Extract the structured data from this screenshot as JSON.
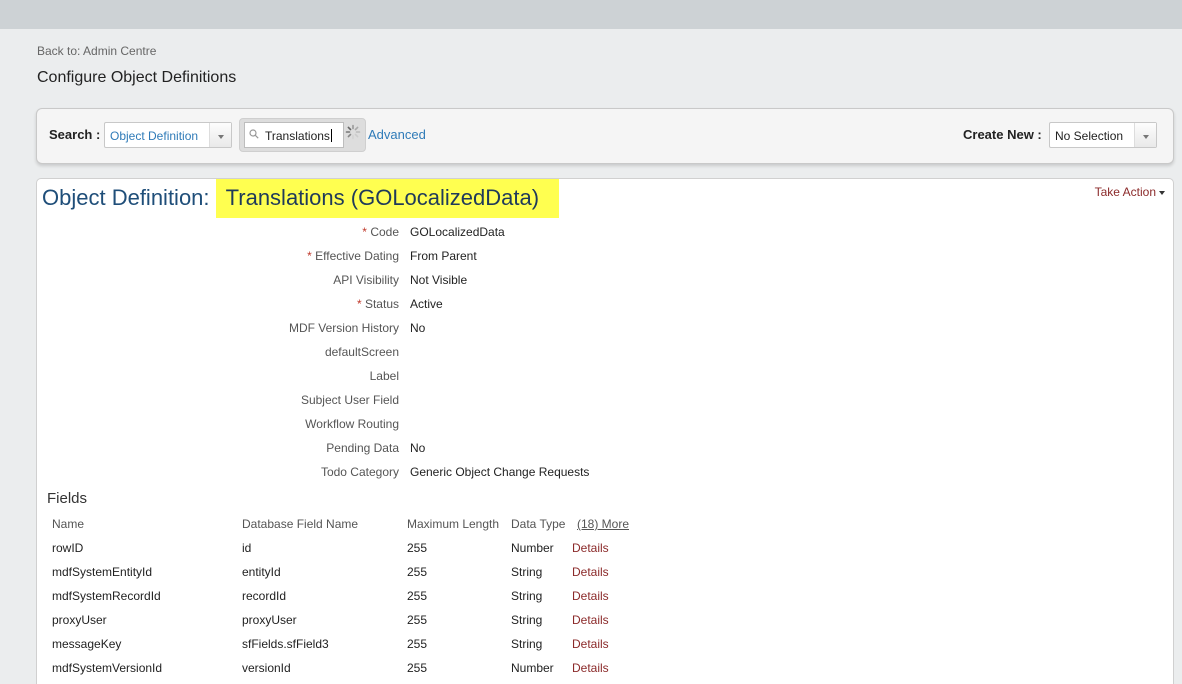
{
  "nav": {
    "back": "Back to: Admin Centre",
    "page_title": "Configure Object Definitions"
  },
  "search": {
    "label": "Search :",
    "type_value": "Object Definition",
    "query": "Translations",
    "advanced": "Advanced",
    "create_label": "Create New :",
    "create_value": "No Selection"
  },
  "object": {
    "prefix": "Object Definition: ",
    "name": "Translations (GOLocalizedData)",
    "take_action": "Take Action"
  },
  "properties": [
    {
      "label": "Code",
      "required": true,
      "value": "GOLocalizedData"
    },
    {
      "label": "Effective Dating",
      "required": true,
      "value": "From Parent"
    },
    {
      "label": "API Visibility",
      "required": false,
      "value": "Not Visible"
    },
    {
      "label": "Status",
      "required": true,
      "value": "Active"
    },
    {
      "label": "MDF Version History",
      "required": false,
      "value": "No"
    },
    {
      "label": "defaultScreen",
      "required": false,
      "value": ""
    },
    {
      "label": "Label",
      "required": false,
      "value": ""
    },
    {
      "label": "Subject User Field",
      "required": false,
      "value": ""
    },
    {
      "label": "Workflow Routing",
      "required": false,
      "value": ""
    },
    {
      "label": "Pending Data",
      "required": false,
      "value": "No"
    },
    {
      "label": "Todo Category",
      "required": false,
      "value": "Generic Object Change Requests"
    }
  ],
  "fields": {
    "heading": "Fields",
    "columns": {
      "name": "Name",
      "db_field": "Database Field Name",
      "max_length": "Maximum Length",
      "data_type": "Data Type",
      "more": "(18) More"
    },
    "details_label": "Details",
    "rows": [
      {
        "name": "rowID",
        "db_field": "id",
        "max_length": "255",
        "data_type": "Number"
      },
      {
        "name": "mdfSystemEntityId",
        "db_field": "entityId",
        "max_length": "255",
        "data_type": "String"
      },
      {
        "name": "mdfSystemRecordId",
        "db_field": "recordId",
        "max_length": "255",
        "data_type": "String"
      },
      {
        "name": "proxyUser",
        "db_field": "proxyUser",
        "max_length": "255",
        "data_type": "String"
      },
      {
        "name": "messageKey",
        "db_field": "sfFields.sfField3",
        "max_length": "255",
        "data_type": "String"
      },
      {
        "name": "mdfSystemVersionId",
        "db_field": "versionId",
        "max_length": "255",
        "data_type": "Number"
      }
    ]
  }
}
